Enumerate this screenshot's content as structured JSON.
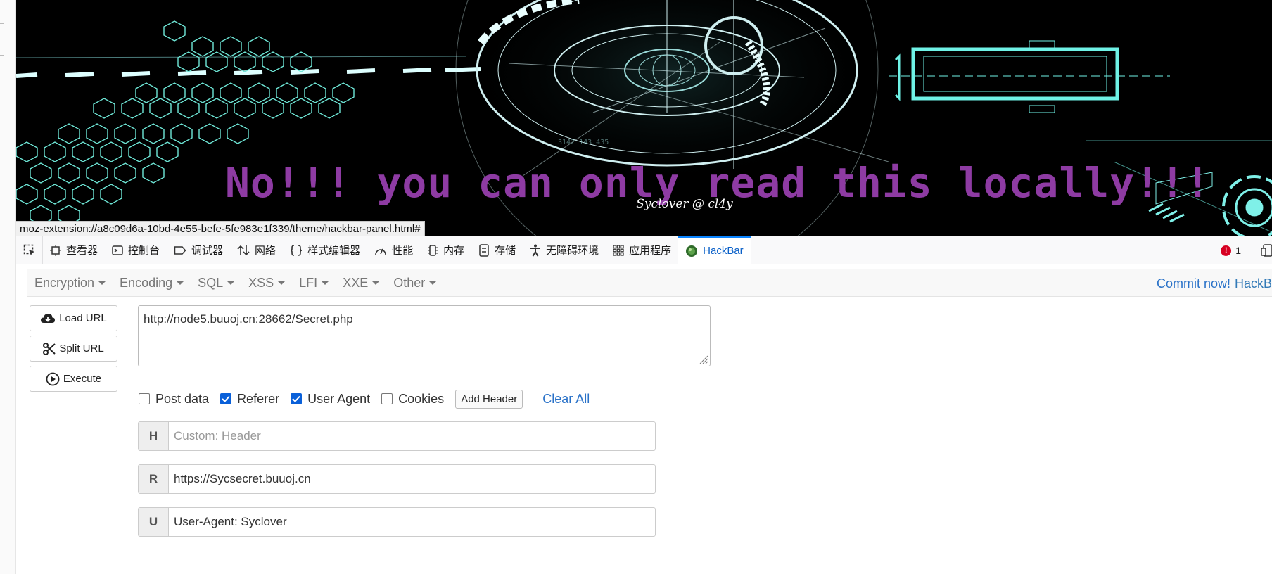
{
  "page": {
    "message": "No!!! you can only read this locally!!!",
    "credit": "Syclover @ cl4y",
    "status_url": "moz-extension://a8c09d6a-10bd-4e55-befe-5fe983e1f339/theme/hackbar-panel.html#"
  },
  "devtools": {
    "tabs": [
      {
        "label": "查看器",
        "icon": "inspector-icon"
      },
      {
        "label": "控制台",
        "icon": "console-icon"
      },
      {
        "label": "调试器",
        "icon": "debugger-icon"
      },
      {
        "label": "网络",
        "icon": "network-icon"
      },
      {
        "label": "样式编辑器",
        "icon": "style-editor-icon"
      },
      {
        "label": "性能",
        "icon": "performance-icon"
      },
      {
        "label": "内存",
        "icon": "memory-icon"
      },
      {
        "label": "存储",
        "icon": "storage-icon"
      },
      {
        "label": "无障碍环境",
        "icon": "accessibility-icon"
      },
      {
        "label": "应用程序",
        "icon": "application-icon"
      },
      {
        "label": "HackBar",
        "icon": "hackbar-icon"
      }
    ],
    "active_tab": "HackBar",
    "error_count": "1",
    "error_glyph": "!"
  },
  "hackbar": {
    "menu": [
      "Encryption",
      "Encoding",
      "SQL",
      "XSS",
      "LFI",
      "XXE",
      "Other"
    ],
    "commit_link": "Commit now!",
    "commit_brand": "HackB",
    "buttons": {
      "load": "Load URL",
      "split": "Split URL",
      "execute": "Execute"
    },
    "url": "http://node5.buuoj.cn:28662/Secret.php",
    "options": {
      "post_data": {
        "label": "Post data",
        "checked": false
      },
      "referer": {
        "label": "Referer",
        "checked": true
      },
      "user_agent": {
        "label": "User Agent",
        "checked": true
      },
      "cookies": {
        "label": "Cookies",
        "checked": false
      }
    },
    "add_header": "Add Header",
    "clear_all": "Clear All",
    "headers": [
      {
        "key": "H",
        "value": "",
        "placeholder": "Custom: Header"
      },
      {
        "key": "R",
        "value": "https://Sycsecret.buuoj.cn",
        "placeholder": ""
      },
      {
        "key": "U",
        "value": "User-Agent: Syclover",
        "placeholder": ""
      }
    ]
  },
  "colors": {
    "accent": "#0a84ff",
    "message": "#8e3ba3",
    "banner_glow": "#7ff0e8",
    "error": "#d70022"
  }
}
